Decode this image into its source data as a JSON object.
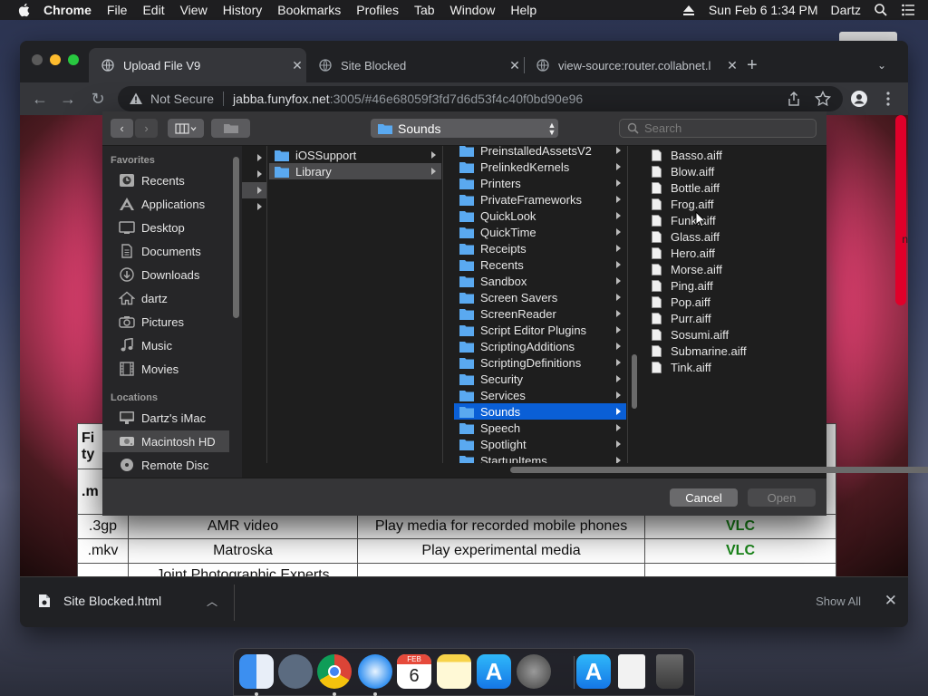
{
  "menubar": {
    "app": "Chrome",
    "items": [
      "File",
      "Edit",
      "View",
      "History",
      "Bookmarks",
      "Profiles",
      "Tab",
      "Window",
      "Help"
    ],
    "datetime": "Sun Feb 6  1:34 PM",
    "user": "Dartz"
  },
  "browser": {
    "tabs": [
      {
        "title": "Upload File V9"
      },
      {
        "title": "Site Blocked"
      },
      {
        "title": "view-source:router.collabnet.l"
      }
    ],
    "omnibox": {
      "security": "Not Secure",
      "host": "jabba.funyfox.net",
      "rest": ":3005/#46e68059f3fd7d6d53f4c40f0bd90e96"
    }
  },
  "page": {
    "edge_text": "n",
    "table_stub": [
      "Fi",
      "ty",
      ".m"
    ],
    "rows": [
      {
        "ext": ".3gp",
        "format": "AMR video",
        "use": "Play media for recorded mobile phones",
        "app": "VLC"
      },
      {
        "ext": ".mkv",
        "format": "Matroska",
        "use": "Play experimental media",
        "app": "VLC"
      },
      {
        "ext": "",
        "format": "Joint Photographic Experts",
        "use": "",
        "app": ""
      }
    ]
  },
  "dialog": {
    "location": "Sounds",
    "search_placeholder": "Search",
    "sidebar": {
      "favorites_label": "Favorites",
      "favorites": [
        {
          "label": "Recents",
          "icon": "clock-icon"
        },
        {
          "label": "Applications",
          "icon": "applications-icon"
        },
        {
          "label": "Desktop",
          "icon": "desktop-icon"
        },
        {
          "label": "Documents",
          "icon": "document-icon"
        },
        {
          "label": "Downloads",
          "icon": "download-icon"
        },
        {
          "label": "dartz",
          "icon": "home-icon"
        },
        {
          "label": "Pictures",
          "icon": "camera-icon"
        },
        {
          "label": "Music",
          "icon": "music-note-icon"
        },
        {
          "label": "Movies",
          "icon": "film-icon"
        }
      ],
      "locations_label": "Locations",
      "locations": [
        {
          "label": "Dartz's iMac",
          "icon": "imac-icon"
        },
        {
          "label": "Macintosh HD",
          "icon": "harddisk-icon",
          "selected": true
        },
        {
          "label": "Remote Disc",
          "icon": "disc-icon"
        }
      ]
    },
    "col2": [
      {
        "name": "iOSSupport",
        "selected": false
      },
      {
        "name": "Library",
        "selected": true
      }
    ],
    "col3": [
      "PreinstalledAssetsV2",
      "PrelinkedKernels",
      "Printers",
      "PrivateFrameworks",
      "QuickLook",
      "QuickTime",
      "Receipts",
      "Recents",
      "Sandbox",
      "Screen Savers",
      "ScreenReader",
      "Script Editor Plugins",
      "ScriptingAdditions",
      "ScriptingDefinitions",
      "Security",
      "Services",
      "Sounds",
      "Speech",
      "Spotlight",
      "StartupItems"
    ],
    "col3_selected": "Sounds",
    "col4": [
      "Basso.aiff",
      "Blow.aiff",
      "Bottle.aiff",
      "Frog.aiff",
      "Funk.aiff",
      "Glass.aiff",
      "Hero.aiff",
      "Morse.aiff",
      "Ping.aiff",
      "Pop.aiff",
      "Purr.aiff",
      "Sosumi.aiff",
      "Submarine.aiff",
      "Tink.aiff"
    ],
    "cancel": "Cancel",
    "open": "Open"
  },
  "shelf": {
    "filename": "Site Blocked.html",
    "show_all": "Show All"
  },
  "dock": {
    "calendar_month": "FEB",
    "calendar_day": "6",
    "apps": [
      "finder-icon",
      "launchpad-icon",
      "chrome-icon",
      "safari-icon",
      "calendar-icon",
      "notes-icon",
      "app-store-icon",
      "system-preferences-icon",
      "app-store-icon",
      "html-file-icon",
      "trash-icon"
    ]
  },
  "colors": {
    "accent": "#0a5fd6",
    "vlc_green": "#1a8a1a",
    "scrollbar_red": "#e0002a"
  }
}
